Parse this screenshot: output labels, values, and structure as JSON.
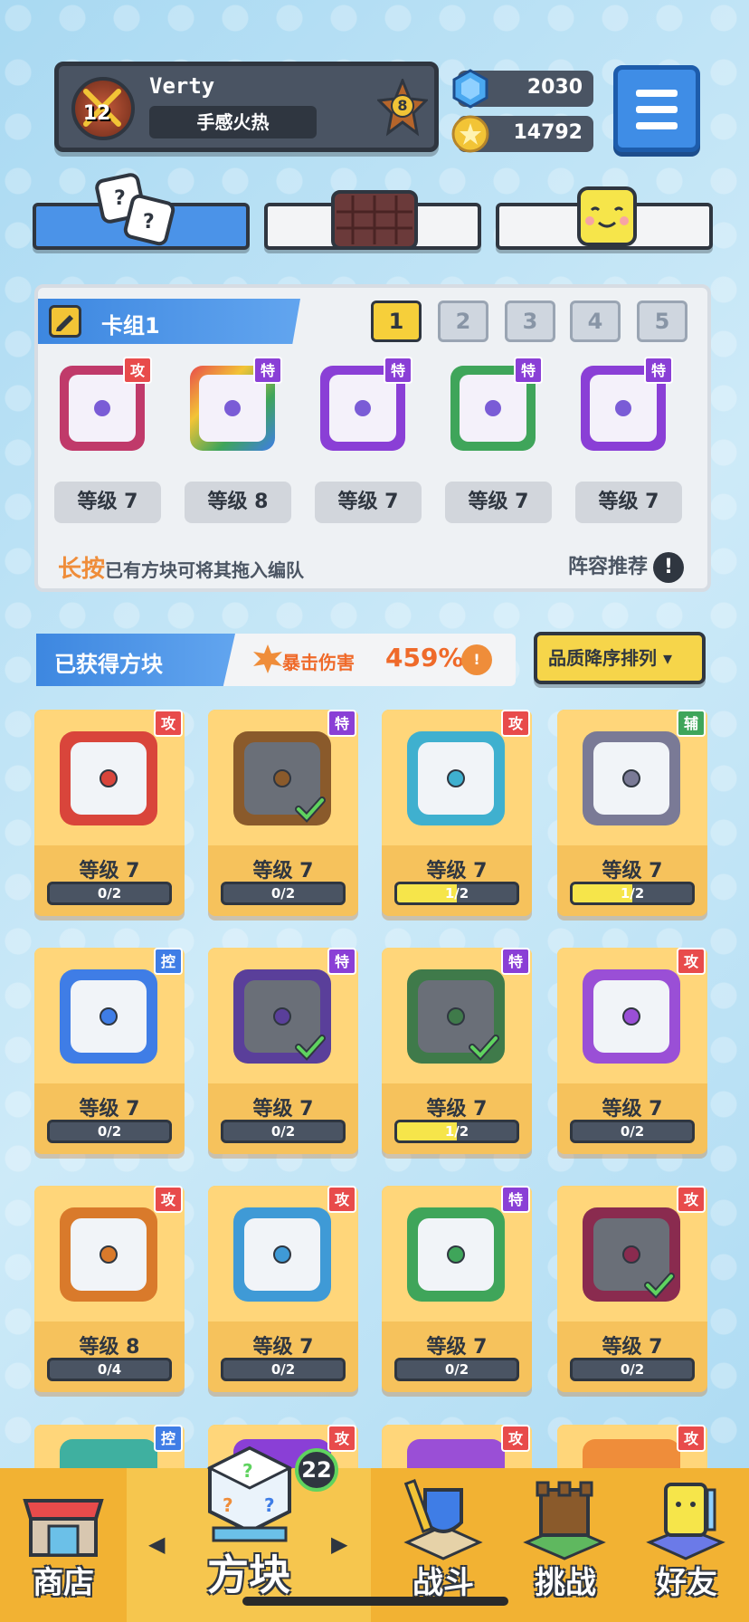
{
  "profile": {
    "name": "Verty",
    "title": "手感火热",
    "avatar_level": "12",
    "rank": "8"
  },
  "currency": {
    "gems": "2030",
    "coins": "14792"
  },
  "deck": {
    "title": "卡组1",
    "numbers": [
      "1",
      "2",
      "3",
      "4",
      "5"
    ],
    "active_index": 0,
    "cards": [
      {
        "badge": "攻",
        "badge_color": "#e84b4b",
        "level": "等级 7",
        "art": "combo"
      },
      {
        "badge": "特",
        "badge_color": "#8a3fd6",
        "level": "等级 8",
        "art": "rainbow"
      },
      {
        "badge": "特",
        "badge_color": "#8a3fd6",
        "level": "等级 7",
        "art": "purple"
      },
      {
        "badge": "特",
        "badge_color": "#8a3fd6",
        "level": "等级 7",
        "art": "green"
      },
      {
        "badge": "特",
        "badge_color": "#8a3fd6",
        "level": "等级 7",
        "art": "infinity"
      }
    ],
    "hint_highlight": "长按",
    "hint_text": "已有方块可将其拖入编队",
    "lineup_recommend": "阵容推荐",
    "lineup_info": "!"
  },
  "owned": {
    "title": "已获得方块",
    "crit_label": "暴击伤害",
    "crit_value": "459%",
    "crit_info": "!",
    "sort_label": "品质降序排列 ▾",
    "cards": [
      {
        "badge": "攻",
        "badge_color": "#e84b4b",
        "frame": "#d9453b",
        "level": "等级 7",
        "progress": "0/2",
        "fill": 0,
        "checked": false
      },
      {
        "badge": "特",
        "badge_color": "#8a3fd6",
        "frame": "#8a5a2b",
        "level": "等级 7",
        "progress": "0/2",
        "fill": 0,
        "checked": true
      },
      {
        "badge": "攻",
        "badge_color": "#e84b4b",
        "frame": "#3fb0cf",
        "level": "等级 7",
        "progress": "1/2",
        "fill": 0.5,
        "checked": false
      },
      {
        "badge": "辅",
        "badge_color": "#3fa55a",
        "frame": "#7a7a96",
        "level": "等级 7",
        "progress": "1/2",
        "fill": 0.5,
        "checked": false
      },
      {
        "badge": "控",
        "badge_color": "#3f7de6",
        "frame": "#3f7de6",
        "level": "等级 7",
        "progress": "0/2",
        "fill": 0,
        "checked": false
      },
      {
        "badge": "特",
        "badge_color": "#8a3fd6",
        "frame": "#5a3f9a",
        "level": "等级 7",
        "progress": "0/2",
        "fill": 0,
        "checked": true
      },
      {
        "badge": "特",
        "badge_color": "#8a3fd6",
        "frame": "#3f7a4a",
        "level": "等级 7",
        "progress": "1/2",
        "fill": 0.5,
        "checked": true
      },
      {
        "badge": "攻",
        "badge_color": "#e84b4b",
        "frame": "#9a4fd6",
        "level": "等级 7",
        "progress": "0/2",
        "fill": 0,
        "checked": false
      },
      {
        "badge": "攻",
        "badge_color": "#e84b4b",
        "frame": "#d97a2b",
        "level": "等级 8",
        "progress": "0/4",
        "fill": 0,
        "checked": false
      },
      {
        "badge": "攻",
        "badge_color": "#e84b4b",
        "frame": "#3f9ad6",
        "level": "等级 7",
        "progress": "0/2",
        "fill": 0,
        "checked": false
      },
      {
        "badge": "特",
        "badge_color": "#8a3fd6",
        "frame": "#3fa55a",
        "level": "等级 7",
        "progress": "0/2",
        "fill": 0,
        "checked": false
      },
      {
        "badge": "攻",
        "badge_color": "#e84b4b",
        "frame": "#8a2b4f",
        "level": "等级 7",
        "progress": "0/2",
        "fill": 0,
        "checked": true
      }
    ],
    "partial_badges": [
      {
        "badge": "控",
        "badge_color": "#3f7de6"
      },
      {
        "badge": "攻",
        "badge_color": "#e84b4b"
      },
      {
        "badge": "攻",
        "badge_color": "#e84b4b"
      },
      {
        "badge": "攻",
        "badge_color": "#e84b4b"
      }
    ]
  },
  "nav": {
    "shop": "商店",
    "dice": "方块",
    "dice_badge": "22",
    "battle": "战斗",
    "challenge": "挑战",
    "friends": "好友",
    "arrow_left": "◀",
    "arrow_right": "▶"
  },
  "icons": {
    "gem": "gem-icon",
    "coin": "coin-icon",
    "menu": "hamburger-menu-icon",
    "edit": "pencil-icon",
    "check": "check-icon"
  }
}
